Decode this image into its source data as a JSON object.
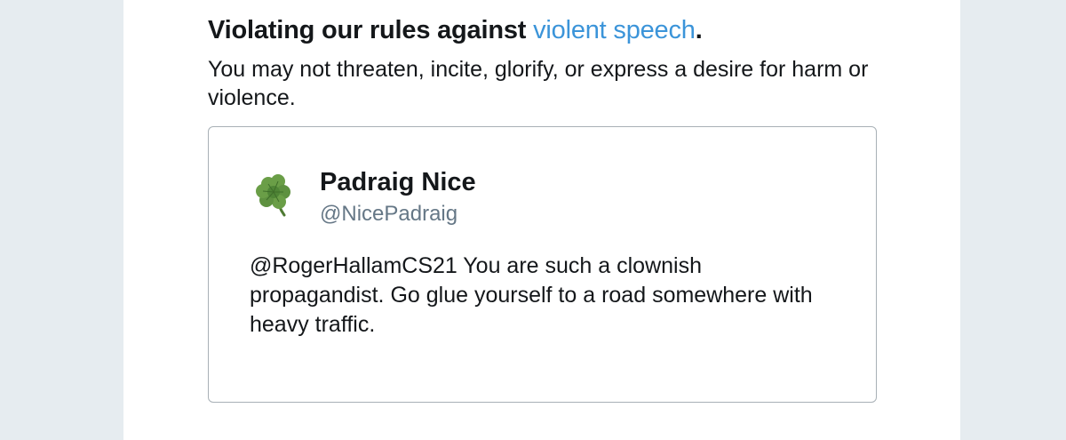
{
  "rule": {
    "heading_prefix": "Violating our rules against ",
    "heading_link": "violent speech",
    "heading_suffix": ".",
    "description": "You may not threaten, incite, glorify, or express a desire for harm or violence."
  },
  "tweet": {
    "author_name": "Padraig Nice",
    "author_handle": "@NicePadraig",
    "avatar_icon": "shamrock-icon",
    "text": "@RogerHallamCS21 You are such a clownish propagandist. Go glue yourself to a road somewhere with heavy traffic."
  },
  "colors": {
    "link": "#3b94d9",
    "handle": "#657786",
    "border": "#a8b0b6",
    "backdrop": "#e6ecf0"
  }
}
